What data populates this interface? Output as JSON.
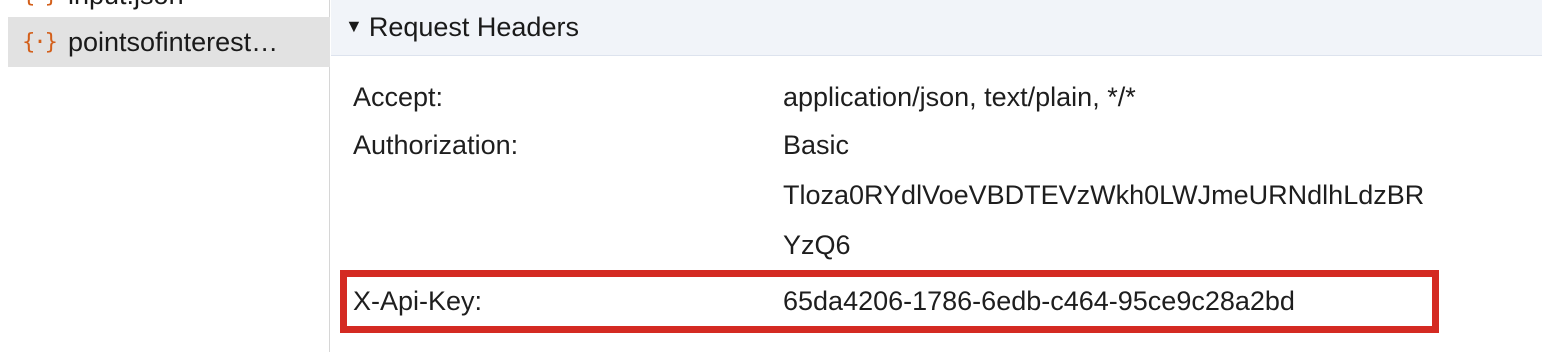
{
  "sidebar": {
    "items": [
      {
        "label": "input.json",
        "icon": "json-file-icon"
      },
      {
        "label": "pointsofinterest…",
        "icon": "json-file-icon",
        "selected": true
      }
    ],
    "icon_glyph": "{·}"
  },
  "request_headers": {
    "section_title": "Request Headers",
    "disclosure_glyph": "▼",
    "rows": [
      {
        "name": "Accept:",
        "value_lines": [
          "application/json, text/plain, */*"
        ]
      },
      {
        "name": "Authorization:",
        "value_lines": [
          "Basic",
          "Tloza0RYdlVoeVBDTEVzWkh0LWJmeURNdlhLdzBR",
          "YzQ6"
        ]
      },
      {
        "name": "X-Api-Key:",
        "value_lines": [
          "65da4206-1786-6edb-c464-95ce9c28a2bd"
        ],
        "highlighted": true
      }
    ]
  },
  "colors": {
    "highlight": "#d42a22",
    "json_icon": "#d35f1a",
    "header_bar": "#f1f4f9",
    "selected_row": "#e2e2e2"
  }
}
